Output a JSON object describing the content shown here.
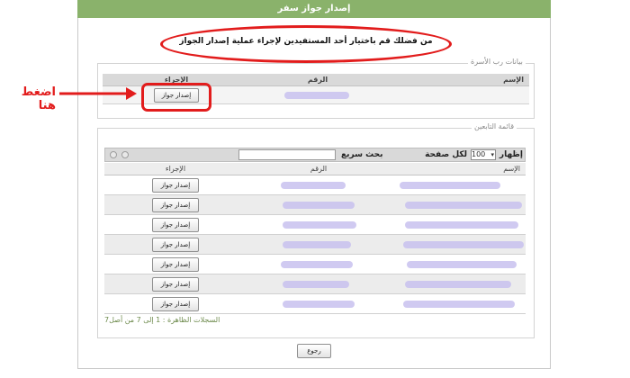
{
  "title_bar": {
    "title": "إصدار جواز سفر"
  },
  "instruction": "من فضلك قم باختيار أحد المستفيدين لإجراء عملية إصدار الجواز",
  "annotation": {
    "label": "اضغط هنا",
    "color": "#e21c1c"
  },
  "family_head": {
    "section_label": "بيانات رب الأسرة",
    "columns": {
      "name": "الإسم",
      "number": "الرقم",
      "action": "الإجراء"
    },
    "issue_button": "إصدار جواز"
  },
  "dependents": {
    "section_label": "قائمة التابعين",
    "show_label": "إظهار",
    "page_size": "100",
    "per_page_label": "لكل صفحة",
    "quick_search_label": "بحث سريع",
    "search_value": "",
    "columns": {
      "name": "الإسم",
      "number": "الرقم",
      "action": "الإجراء"
    },
    "rows": [
      {
        "button": "إصدار جواز"
      },
      {
        "button": "إصدار جواز"
      },
      {
        "button": "إصدار جواز"
      },
      {
        "button": "إصدار جواز"
      },
      {
        "button": "إصدار جواز"
      },
      {
        "button": "إصدار جواز"
      },
      {
        "button": "إصدار جواز"
      }
    ],
    "footer": "السجلات الظاهرة : 1 إلى 7 من أصل7"
  },
  "back_button": "رجوع",
  "colors": {
    "title_bar": "#8ab26b",
    "redacted": "#c8c1ef",
    "highlight": "#e21c1c"
  }
}
